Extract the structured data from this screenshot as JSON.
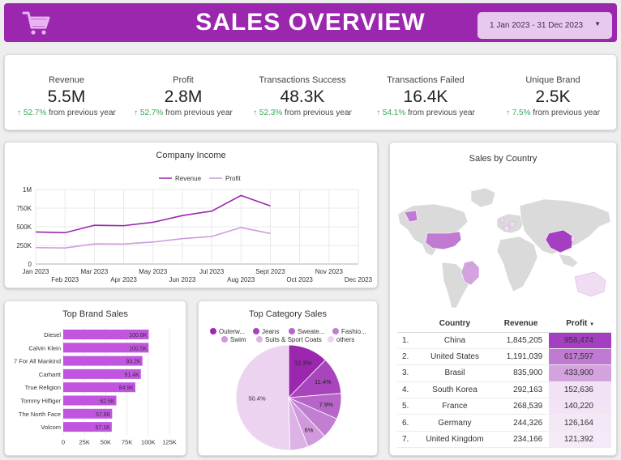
{
  "header": {
    "title": "SALES OVERVIEW",
    "date_range": "1 Jan 2023 - 31 Dec 2023"
  },
  "kpis": [
    {
      "label": "Revenue",
      "value": "5.5M",
      "change": "52.7%",
      "suffix": "from previous year"
    },
    {
      "label": "Profit",
      "value": "2.8M",
      "change": "52.7%",
      "suffix": "from previous year"
    },
    {
      "label": "Transactions Success",
      "value": "48.3K",
      "change": "52.3%",
      "suffix": "from previous year"
    },
    {
      "label": "Transactions Failed",
      "value": "16.4K",
      "change": "54.1%",
      "suffix": "from previous year"
    },
    {
      "label": "Unique Brand",
      "value": "2.5K",
      "change": "7.5%",
      "suffix": "from previous year"
    }
  ],
  "chart_data": [
    {
      "type": "line",
      "title": "Company Income",
      "x": [
        "Jan 2023",
        "Feb 2023",
        "Mar 2023",
        "Apr 2023",
        "May 2023",
        "Jun 2023",
        "Jul 2023",
        "Aug 2023",
        "Sept 2023",
        "Oct 2023",
        "Nov 2023",
        "Dec 2023"
      ],
      "yticks": [
        "0",
        "250K",
        "500K",
        "750K",
        "1M"
      ],
      "ylim": [
        0,
        1000000
      ],
      "series": [
        {
          "name": "Revenue",
          "color": "#9b27af",
          "values": [
            430000,
            420000,
            520000,
            515000,
            560000,
            650000,
            710000,
            920000,
            780000,
            null,
            null,
            null
          ]
        },
        {
          "name": "Profit",
          "color": "#cf9be0",
          "values": [
            220000,
            215000,
            270000,
            268000,
            295000,
            340000,
            370000,
            490000,
            410000,
            null,
            null,
            null
          ]
        }
      ],
      "grid": true,
      "legend": "top"
    },
    {
      "type": "bar",
      "title": "Top Brand Sales",
      "orientation": "horizontal",
      "categories": [
        "Diesel",
        "Calvin Klein",
        "7 For All Mankind",
        "Carhartt",
        "True Religion",
        "Tommy Hilfiger",
        "The North Face",
        "Volcom"
      ],
      "values": [
        100600,
        100500,
        93200,
        91400,
        84900,
        62500,
        57600,
        57100
      ],
      "labels": [
        "100.6K",
        "100.5K",
        "93.2K",
        "91.4K",
        "84.9K",
        "62.5K",
        "57.6K",
        "57.1K"
      ],
      "xticks": [
        "0",
        "25K",
        "50K",
        "75K",
        "100K",
        "125K"
      ],
      "xlim": [
        0,
        125000
      ],
      "color": "#c155e0"
    },
    {
      "type": "pie",
      "title": "Top Category Sales",
      "slices": [
        {
          "name": "Outerw...",
          "value": 12.3,
          "label": "12.3%",
          "color": "#9b27af"
        },
        {
          "name": "Jeans",
          "value": 11.4,
          "label": "11.4%",
          "color": "#a845bd"
        },
        {
          "name": "Sweate...",
          "value": 7.9,
          "label": "7.9%",
          "color": "#b765c8"
        },
        {
          "name": "Fashio...",
          "value": 6.4,
          "label": "",
          "color": "#c27fd1"
        },
        {
          "name": "Swim",
          "value": 6.0,
          "label": "6%",
          "color": "#d099db"
        },
        {
          "name": "Suits & Sport Coats",
          "value": 5.6,
          "label": "",
          "color": "#ddb3e6"
        },
        {
          "name": "others",
          "value": 50.4,
          "label": "50.4%",
          "color": "#ecd4f0"
        }
      ]
    }
  ],
  "country": {
    "title": "Sales by Country",
    "headers": [
      "Country",
      "Revenue",
      "Profit"
    ],
    "sort_icon": "sort-desc-icon",
    "rows": [
      {
        "rank": "1.",
        "country": "China",
        "revenue": "1,845,205",
        "profit": "956,474",
        "shade": "#a33fc0"
      },
      {
        "rank": "2.",
        "country": "United States",
        "revenue": "1,191,039",
        "profit": "617,597",
        "shade": "#c07ad1"
      },
      {
        "rank": "3.",
        "country": "Brasil",
        "revenue": "835,900",
        "profit": "433,900",
        "shade": "#d4a3df"
      },
      {
        "rank": "4.",
        "country": "South Korea",
        "revenue": "292,163",
        "profit": "152,636",
        "shade": "#f1e2f5"
      },
      {
        "rank": "5.",
        "country": "France",
        "revenue": "268,539",
        "profit": "140,220",
        "shade": "#f2e4f6"
      },
      {
        "rank": "6.",
        "country": "Germany",
        "revenue": "244,326",
        "profit": "126,164",
        "shade": "#f4e8f7"
      },
      {
        "rank": "7.",
        "country": "United Kingdom",
        "revenue": "234,166",
        "profit": "121,392",
        "shade": "#f5eaf8"
      }
    ]
  },
  "icons": {
    "cart": "cart-icon",
    "dropdown": "chevron-down-icon",
    "arrow_up": "arrow-up-icon"
  },
  "colors": {
    "brand": "#9b27af",
    "positive": "#34a853"
  }
}
